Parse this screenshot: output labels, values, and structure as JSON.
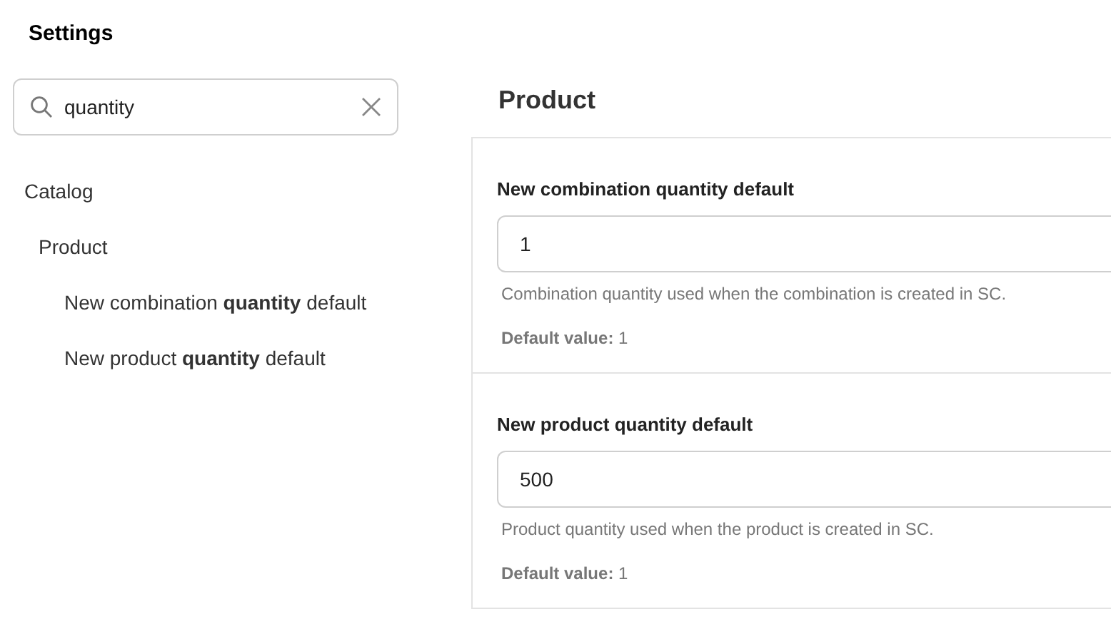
{
  "title": "Settings",
  "search": {
    "value": "quantity"
  },
  "tree": [
    {
      "label": "Catalog",
      "children": [
        {
          "label": "Product",
          "children": [
            {
              "label": "New combination **quantity** default"
            },
            {
              "label": "New product **quantity** default"
            }
          ]
        }
      ]
    }
  ],
  "panel": {
    "title": "Product",
    "settings": [
      {
        "label": "New combination quantity default",
        "value": "1",
        "description": "Combination quantity used when the combination is created in SC.",
        "default": "**Default value:** 1"
      },
      {
        "label": "New product quantity default",
        "value": "500",
        "description": "Product quantity used when the product is created in SC.",
        "default": "**Default value:** 1"
      }
    ]
  }
}
